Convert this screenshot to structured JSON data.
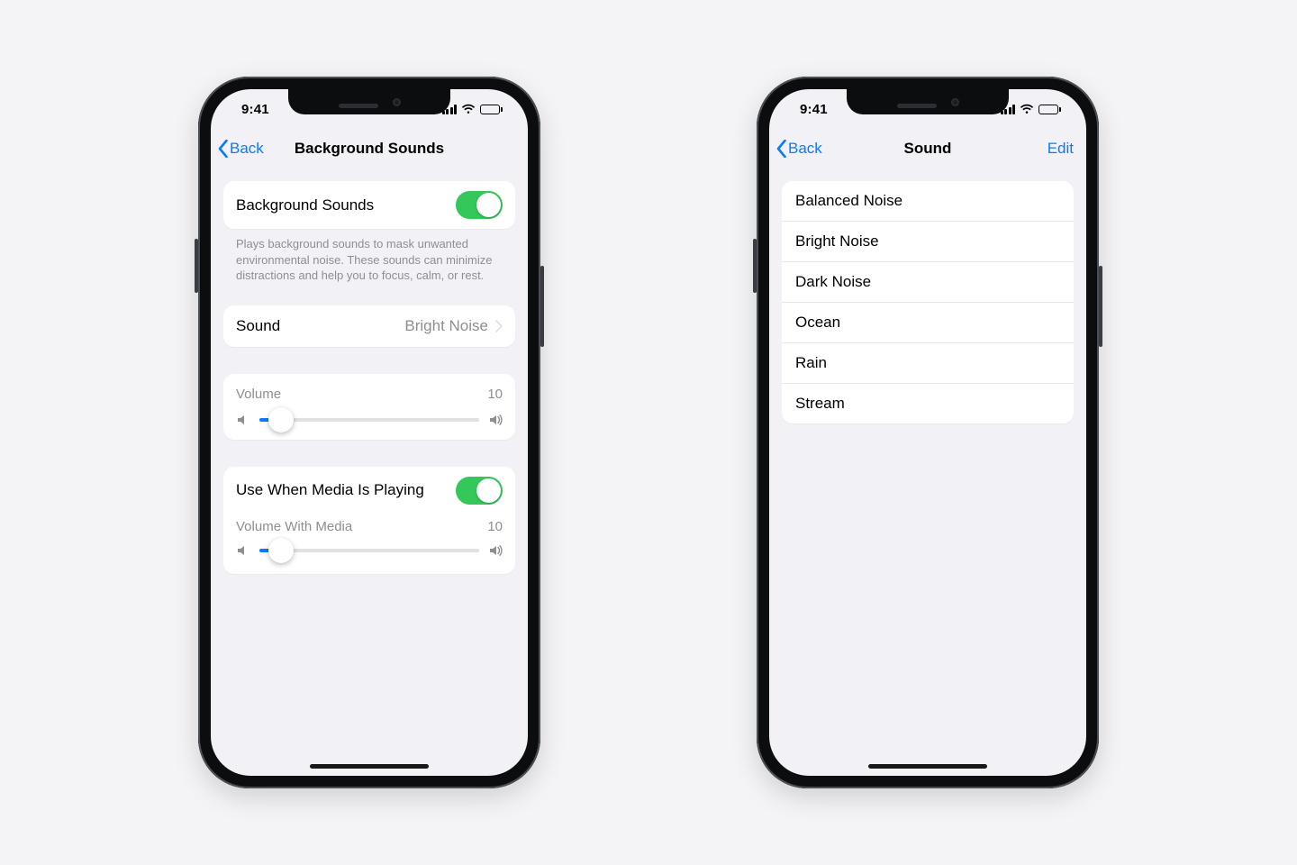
{
  "status": {
    "time": "9:41"
  },
  "left": {
    "nav": {
      "back": "Back",
      "title": "Background Sounds"
    },
    "master": {
      "label": "Background Sounds",
      "footnote": "Plays background sounds to mask unwanted environmental noise. These sounds can minimize distractions and help you to focus, calm, or rest."
    },
    "sound_row": {
      "label": "Sound",
      "value": "Bright Noise"
    },
    "volume": {
      "label": "Volume",
      "value": "10"
    },
    "media": {
      "use_label": "Use When Media Is Playing",
      "vol_label": "Volume With Media",
      "vol_value": "10"
    }
  },
  "right": {
    "nav": {
      "back": "Back",
      "title": "Sound",
      "edit": "Edit"
    },
    "sounds": [
      "Balanced Noise",
      "Bright Noise",
      "Dark Noise",
      "Ocean",
      "Rain",
      "Stream"
    ]
  }
}
